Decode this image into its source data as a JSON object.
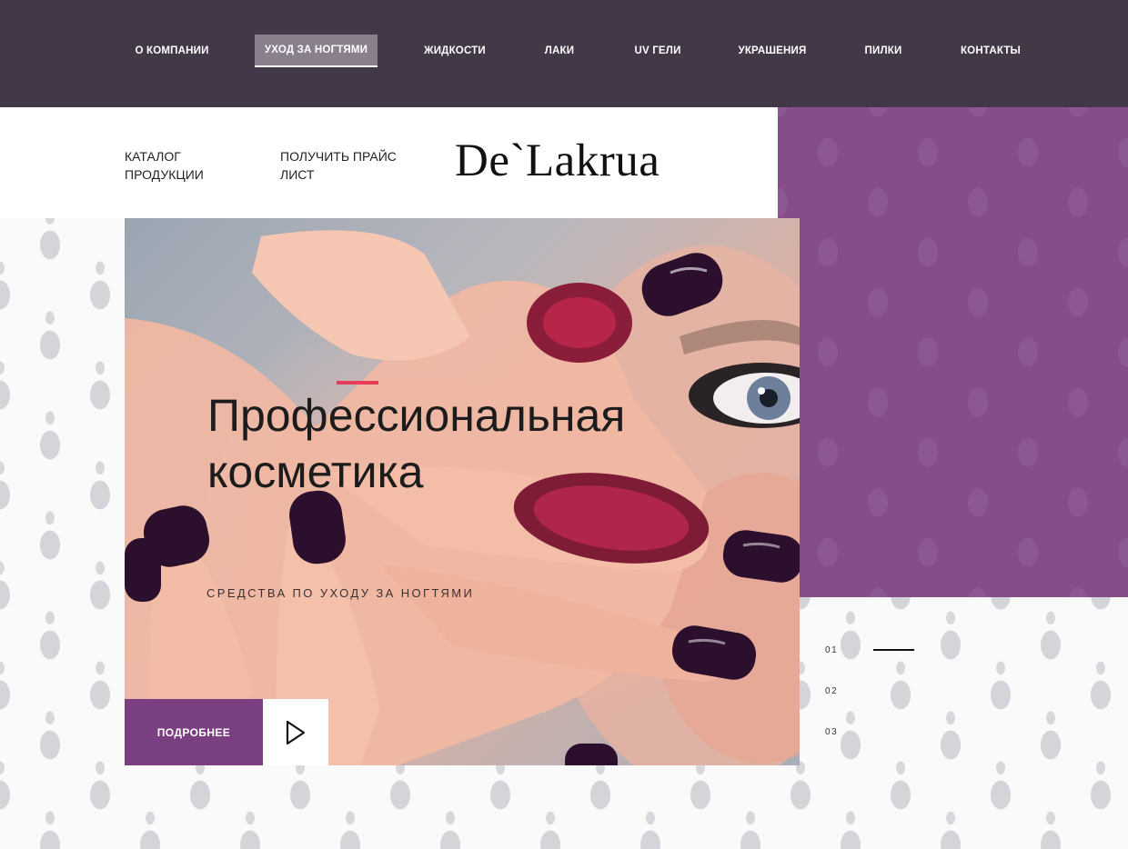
{
  "nav": {
    "items": [
      {
        "label": "О КОМПАНИИ",
        "active": false
      },
      {
        "label": "УХОД ЗА НОГТЯМИ",
        "active": true
      },
      {
        "label": "ЖИДКОСТИ",
        "active": false
      },
      {
        "label": "ЛАКИ",
        "active": false
      },
      {
        "label": "UV ГЕЛИ",
        "active": false
      },
      {
        "label": "УКРАШЕНИЯ",
        "active": false
      },
      {
        "label": "ПИЛКИ",
        "active": false
      },
      {
        "label": "КОНТАКТЫ",
        "active": false
      }
    ]
  },
  "header": {
    "catalog_label": "КАТАЛОГ ПРОДУКЦИИ",
    "price_label": "ПОЛУЧИТЬ ПРАЙС ЛИСТ",
    "logo_text": "De`Lakrua"
  },
  "hero": {
    "title_line1": "Профессиональная",
    "title_line2": "косметика",
    "subtitle": "СРЕДСТВА ПО УХОДУ ЗА НОГТЯМИ",
    "more_label": "ПОДРОБНЕЕ",
    "play_icon": "play-icon"
  },
  "pager": {
    "items": [
      "01",
      "02",
      "03"
    ],
    "active_index": 0
  },
  "colors": {
    "nav_bg": "#433847",
    "nav_active_bg": "#8a7f8d",
    "brand_purple": "#864d8c",
    "button_purple": "#7a3f80",
    "accent_red": "#e83a5a"
  }
}
